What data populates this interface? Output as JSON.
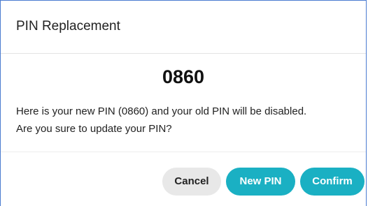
{
  "dialog": {
    "title": "PIN Replacement",
    "pin": "0860",
    "message_line1": "Here is your new PIN (0860) and your old PIN will be disabled.",
    "message_line2": "Are you sure to update your PIN?"
  },
  "buttons": {
    "cancel": "Cancel",
    "new_pin": "New PIN",
    "confirm": "Confirm"
  },
  "colors": {
    "accent": "#1ab0c3",
    "secondary_button": "#e8e8e8",
    "border": "#4a7bd0"
  }
}
